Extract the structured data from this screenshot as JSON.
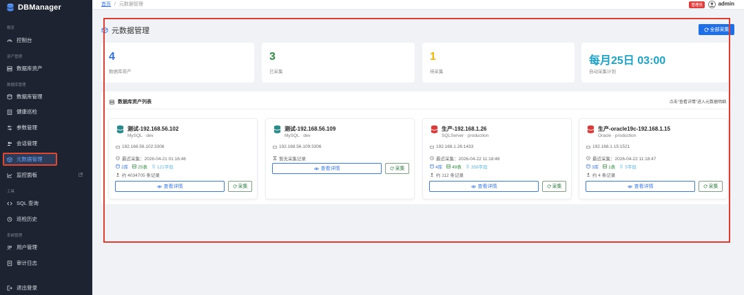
{
  "brand": {
    "name": "DBManager"
  },
  "sidebar": {
    "sections": [
      "概览",
      "资产管理",
      "数据库管理",
      "工具",
      "系统管理"
    ],
    "items": [
      {
        "label": "控制台",
        "icon": "dashboard-icon"
      },
      {
        "label": "数据库资产",
        "icon": "server-icon"
      },
      {
        "label": "数据库管理",
        "icon": "database-icon"
      },
      {
        "label": "健康巡检",
        "icon": "clipboard-icon"
      },
      {
        "label": "参数管理",
        "icon": "sliders-icon"
      },
      {
        "label": "会话管理",
        "icon": "users-icon"
      },
      {
        "label": "元数据管理",
        "icon": "cube-icon",
        "active": true
      },
      {
        "label": "监控面板",
        "icon": "chart-icon"
      },
      {
        "label": "SQL 查询",
        "icon": "code-icon"
      },
      {
        "label": "巡检历史",
        "icon": "history-icon"
      },
      {
        "label": "用户管理",
        "icon": "user-group-icon"
      },
      {
        "label": "审计日志",
        "icon": "log-icon"
      },
      {
        "label": "退出登录",
        "icon": "logout-icon"
      }
    ]
  },
  "header": {
    "breadcrumb_home": "首页",
    "breadcrumb_sep": "/",
    "breadcrumb_current": "元数据管理",
    "role_badge": "管理员",
    "username": "admin"
  },
  "page": {
    "title": "元数据管理",
    "collect_all_label": "全部采集"
  },
  "stats": [
    {
      "value": "4",
      "label": "数据库资产",
      "color": "#2f6fec"
    },
    {
      "value": "3",
      "label": "已采集",
      "color": "#2c8c3d"
    },
    {
      "value": "1",
      "label": "待采集",
      "color": "#f0b400"
    },
    {
      "value": "每月25日 03:00",
      "label": "自动采集计划",
      "color": "#1aa3c9"
    }
  ],
  "list": {
    "title": "数据库资产列表",
    "hint": "点击\"查看详情\"进入元数据明细"
  },
  "cards": [
    {
      "name": "测试-192.168.56.102",
      "sub": "MySQL · dev",
      "address": "192.168.56.102:3306",
      "last_collect": "最近采集：2026-04-21 01:16:46",
      "db_count": "2库",
      "table_count": "25表",
      "column_count": "121字段",
      "index_text": "约 4034705 条记录",
      "icon_color": "#2a8a8a",
      "detail_label": "查看详情",
      "collect_label": "采集"
    },
    {
      "name": "测试-192.168.56.109",
      "sub": "MySQL · dev",
      "address": "192.168.56.109:3306",
      "last_collect": "暂无采集记录",
      "detail_label": "查看详情",
      "collect_label": "采集",
      "icon_color": "#2a8a8a"
    },
    {
      "name": "生产-192.168.1.26",
      "sub": "SQLServer · production",
      "address": "192.168.1.26:1433",
      "last_collect": "最近采集：2026-04-22 11:18:48",
      "db_count": "4库",
      "table_count": "49表",
      "column_count": "359字段",
      "index_text": "约 112 条记录",
      "icon_color": "#d93a3a",
      "detail_label": "查看详情",
      "collect_label": "采集"
    },
    {
      "name": "生产-oracle19c-192.168.1.15",
      "sub": "Oracle · production",
      "address": "192.168.1.15:1521",
      "last_collect": "最近采集：2026-04-22 11:18:47",
      "db_count": "3库",
      "table_count": "1表",
      "column_count": "5字段",
      "index_text": "约 4 条记录",
      "icon_color": "#d93a3a",
      "detail_label": "查看详情",
      "collect_label": "采集"
    }
  ]
}
